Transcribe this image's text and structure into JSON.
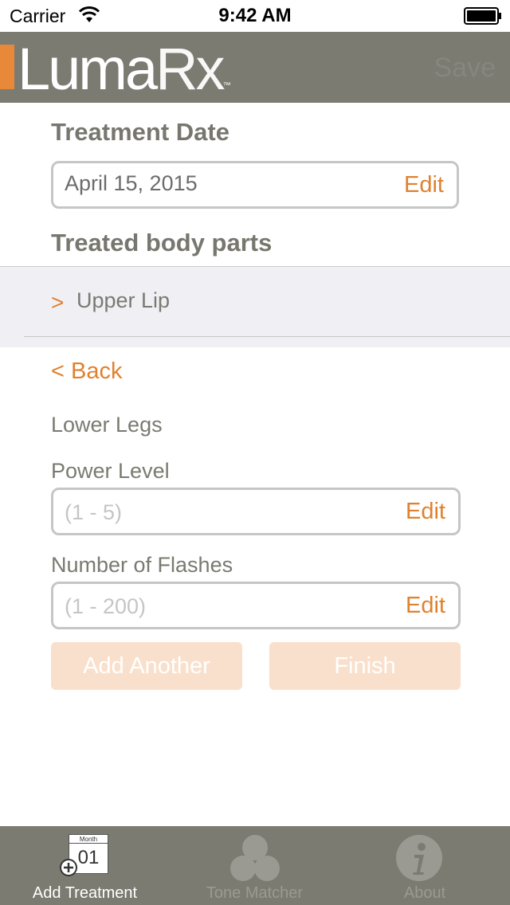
{
  "status_bar": {
    "carrier": "Carrier",
    "time": "9:42 AM"
  },
  "nav": {
    "logo_luma": "Luma",
    "logo_rx": "Rx",
    "logo_tm": "™",
    "save_label": "Save"
  },
  "treatment_date": {
    "title": "Treatment Date",
    "value": "April 15, 2015",
    "edit_label": "Edit"
  },
  "body_parts": {
    "title": "Treated body parts",
    "items": [
      {
        "chevron": ">",
        "label": "Upper Lip"
      }
    ]
  },
  "detail": {
    "back_label": "< Back",
    "body_part": "Lower Legs",
    "power_level": {
      "label": "Power Level",
      "placeholder": "(1 - 5)",
      "edit_label": "Edit"
    },
    "flashes": {
      "label": "Number of Flashes",
      "placeholder": "(1 - 200)",
      "edit_label": "Edit"
    },
    "add_another_label": "Add Another",
    "finish_label": "Finish"
  },
  "tab_bar": {
    "tabs": [
      {
        "label": "Add Treatment",
        "icon": "calendar-add-icon",
        "calendar_month": "Month",
        "calendar_day": "01",
        "active": true
      },
      {
        "label": "Tone Matcher",
        "icon": "tone-circles-icon",
        "active": false
      },
      {
        "label": "About",
        "icon": "info-icon",
        "active": false
      }
    ]
  },
  "colors": {
    "accent": "#e0812e",
    "nav_background": "#7b7b72",
    "disabled_button": "#f9e0cc"
  }
}
